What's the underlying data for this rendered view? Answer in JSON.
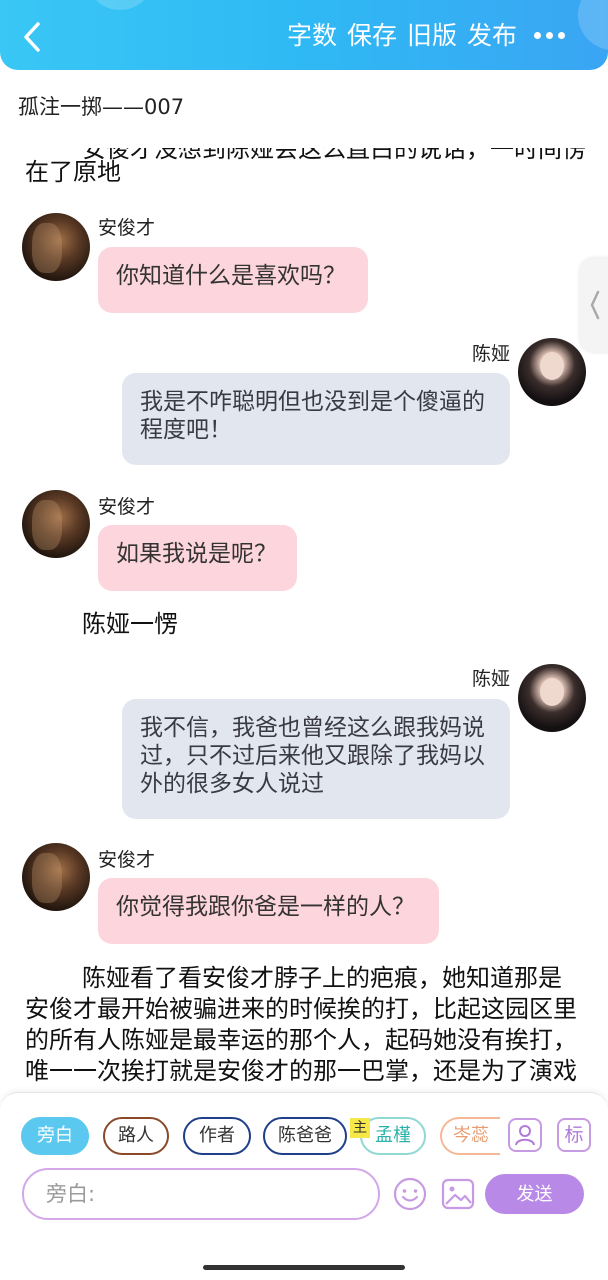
{
  "header": {
    "word_count": "字数",
    "save": "保存",
    "old_version": "旧版",
    "publish": "发布"
  },
  "story_title": "孤注一掷——007",
  "messages": {
    "narration_top_cut": "安俊才没想到陈娅会这么直白的说话，一时间愣",
    "narration_top": "在了原地",
    "msg1_name": "安俊才",
    "msg1_text": "你知道什么是喜欢吗？",
    "msg2_name": "陈娅",
    "msg2_text": "我是不咋聪明但也没到是个傻逼的程度吧！",
    "msg3_name": "安俊才",
    "msg3_text": "如果我说是呢？",
    "narration_mid": "陈娅一愣",
    "msg4_name": "陈娅",
    "msg4_text": "我不信，我爸也曾经这么跟我妈说过，只不过后来他又跟除了我妈以外的很多女人说过",
    "msg5_name": "安俊才",
    "msg5_text": "你觉得我跟你爸是一样的人？",
    "narration_bottom": "陈娅看了看安俊才脖子上的疤痕，她知道那是安俊才最开始被骗进来的时候挨的打，比起这园区里的所有人陈娅是最幸运的那个人，起码她没有挨打，唯一一次挨打就是安俊才的那一巴掌，还是为了演戏"
  },
  "characters": {
    "narrator": "旁白",
    "passerby": "路人",
    "author": "作者",
    "dad": "陈爸爸",
    "mengjin": "孟槿",
    "cenrui": "岑蕊",
    "main_badge": "主"
  },
  "tools": {
    "profile": "",
    "mark": "标"
  },
  "input": {
    "placeholder": "旁白:",
    "value": ""
  },
  "send_label": "发送",
  "colors": {
    "header_blue": "#2fb9f4",
    "pink_bubble": "#fdd5dc",
    "grey_bubble": "#e2e6ee",
    "accent_purple": "#b889e6",
    "narrator_chip": "#5bc8f0"
  }
}
